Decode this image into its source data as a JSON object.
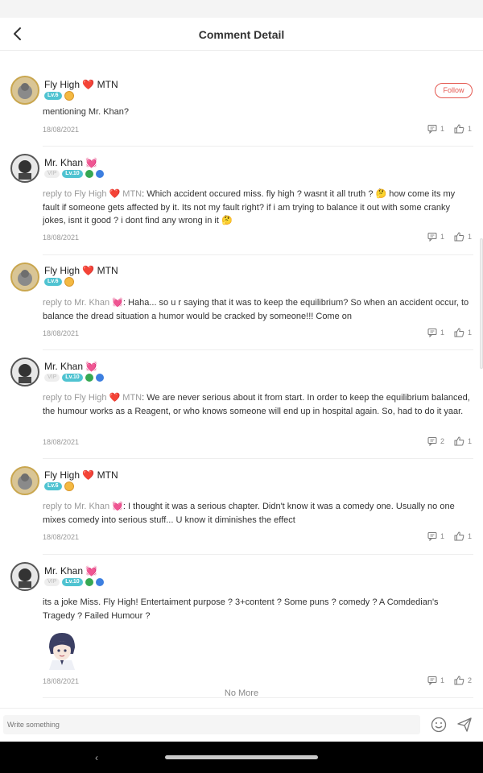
{
  "header": {
    "title": "Comment Detail"
  },
  "follow_label": "Follow",
  "comments": [
    {
      "author": "Fly High ❤️ MTN",
      "level": "Lv.6",
      "reply_to": "",
      "text": "mentioning Mr. Khan?",
      "date": "18/08/2021",
      "replies": "1",
      "likes": "1"
    },
    {
      "author": "Mr. Khan 💓",
      "vip": "VIP",
      "level": "Lv.10",
      "reply_to": "reply to Fly High ❤️ MTN",
      "text": "Which accident occured miss. fly high ? wasnt it all truth ? 🤔 how come its my fault if someone gets affected by it. Its not my fault right? if i am trying to balance it out with some cranky jokes, isnt it good ? i dont find any wrong in it 🤔",
      "date": "18/08/2021",
      "replies": "1",
      "likes": "1"
    },
    {
      "author": "Fly High ❤️ MTN",
      "level": "Lv.6",
      "reply_to": "reply to Mr. Khan 💓",
      "text": "Haha... so u r saying that it was to keep the equilibrium? So when an accident occur, to balance the dread situation a humor would be cracked by someone!!! Come on",
      "date": "18/08/2021",
      "replies": "1",
      "likes": "1"
    },
    {
      "author": "Mr. Khan 💓",
      "vip": "VIP",
      "level": "Lv.10",
      "reply_to": "reply to Fly High ❤️ MTN",
      "text": "We are never serious about it from start. In order to keep the equilibrium balanced, the humour works as a Reagent, or who knows someone will end up in hospital again. So, had to do it yaar.",
      "date": "18/08/2021",
      "replies": "2",
      "likes": "1"
    },
    {
      "author": "Fly High ❤️ MTN",
      "level": "Lv.6",
      "reply_to": "reply to Mr. Khan 💓",
      "text": "I thought it was a serious chapter. Didn't know it was a comedy one. Usually no one mixes comedy into serious stuff... U know it diminishes the effect",
      "date": "18/08/2021",
      "replies": "1",
      "likes": "1"
    },
    {
      "author": "Mr. Khan 💓",
      "vip": "VIP",
      "level": "Lv.10",
      "reply_to": "",
      "text": "its a joke Miss. Fly High! Entertaiment purpose ? 3+content ? Some puns  ? comedy ? A Comdedian's Tragedy ? Failed Humour ?",
      "date": "18/08/2021",
      "replies": "1",
      "likes": "2"
    }
  ],
  "no_more": "No More",
  "composer": {
    "placeholder": "Write something"
  },
  "colors": {
    "accent": "#e4574f",
    "level_badge": "#4fc3d1",
    "heart": "#d9303a"
  }
}
